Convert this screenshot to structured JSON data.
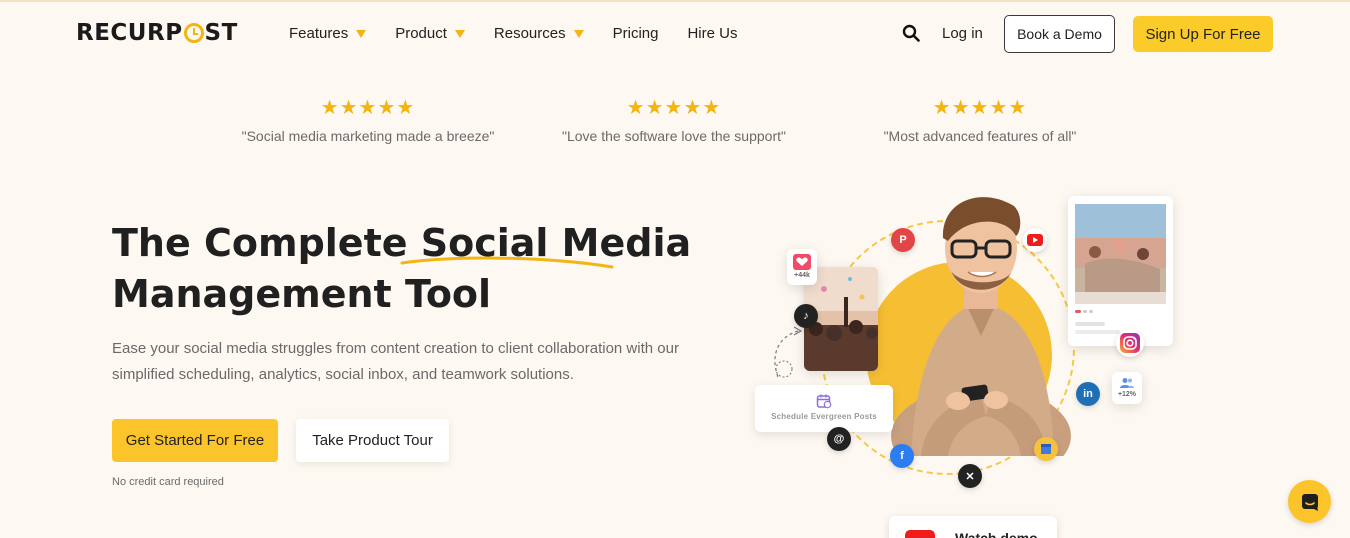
{
  "brand": {
    "logo_text_left": "RECURP",
    "logo_text_right": "ST"
  },
  "nav": {
    "items": [
      {
        "label": "Features",
        "has_caret": true
      },
      {
        "label": "Product",
        "has_caret": true
      },
      {
        "label": "Resources",
        "has_caret": true
      },
      {
        "label": "Pricing",
        "has_caret": false
      },
      {
        "label": "Hire Us",
        "has_caret": false
      }
    ],
    "login_label": "Log in",
    "book_demo_label": "Book a Demo",
    "signup_label": "Sign Up For Free"
  },
  "reviews": [
    {
      "stars": "★★★★★",
      "quote": "\"Social media marketing made a breeze\""
    },
    {
      "stars": "★★★★★",
      "quote": "\"Love the software love the support\""
    },
    {
      "stars": "★★★★★",
      "quote": "\"Most advanced features of all\""
    }
  ],
  "hero": {
    "title_part1": "The Complete ",
    "title_highlight": "Social Media",
    "title_part2": "Management Tool",
    "subtitle": "Ease your social media struggles from content creation to client collaboration with our simplified scheduling, analytics, social inbox, and teamwork solutions.",
    "primary_cta": "Get Started For Free",
    "secondary_cta": "Take Product Tour",
    "note": "No credit card required"
  },
  "illustration": {
    "likes": "+44k",
    "followers": "+12%",
    "schedule_label": "Schedule Evergreen Posts",
    "watch_demo_label": "Watch demo"
  },
  "colors": {
    "accent": "#fbc42a",
    "background": "#fdf8f1",
    "text": "#202020"
  }
}
